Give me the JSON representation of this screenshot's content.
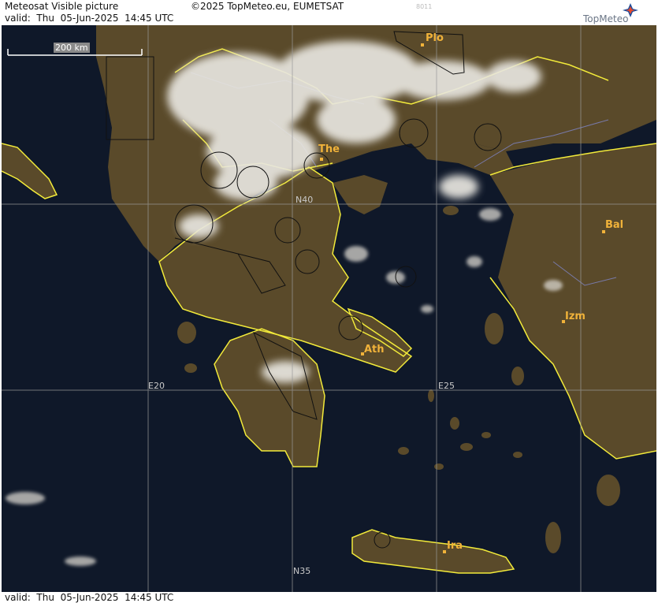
{
  "header": {
    "title": "Meteosat Visible picture",
    "valid": "valid:  Thu  05-Jun-2025  14:45 UTC",
    "copyright": "©2025 TopMeteo.eu, EUMETSAT",
    "code": "8011"
  },
  "logo": {
    "text": "TopMeteo"
  },
  "footer": {
    "valid": "valid:  Thu  05-Jun-2025  14:45 UTC"
  },
  "scale": {
    "label": "200 km"
  },
  "grid_labels": {
    "n40": "N40",
    "e20": "E20",
    "e25": "E25",
    "n35": "N35"
  },
  "cities": {
    "plo": "Plo",
    "the": "The",
    "bal": "Bal",
    "izm": "Izm",
    "ath": "Ath",
    "ira": "Ira"
  },
  "colors": {
    "sea": "#0f1829",
    "land": "#5a4a2a",
    "border": "#f2ea3a",
    "cloud": "#e8e6e0",
    "grid": "#9a9a9a",
    "city": "#f0b23a"
  }
}
